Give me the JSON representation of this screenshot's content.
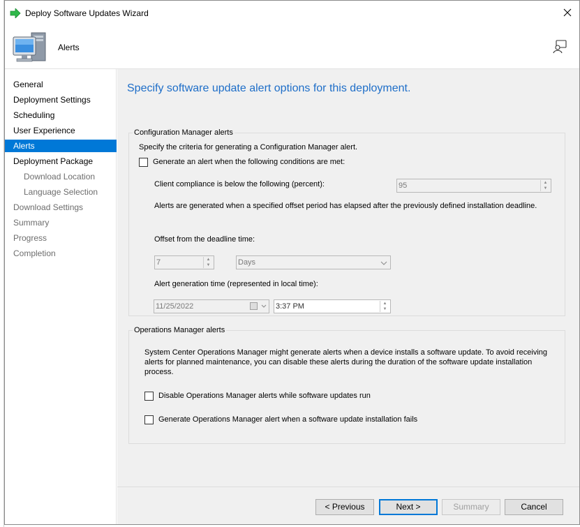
{
  "window": {
    "title": "Deploy Software Updates Wizard"
  },
  "header": {
    "page_name": "Alerts"
  },
  "nav": {
    "items": [
      {
        "label": "General",
        "state": "normal",
        "level": 0
      },
      {
        "label": "Deployment Settings",
        "state": "normal",
        "level": 0
      },
      {
        "label": "Scheduling",
        "state": "normal",
        "level": 0
      },
      {
        "label": "User Experience",
        "state": "normal",
        "level": 0
      },
      {
        "label": "Alerts",
        "state": "active",
        "level": 0
      },
      {
        "label": "Deployment Package",
        "state": "normal",
        "level": 0
      },
      {
        "label": "Download Location",
        "state": "dim",
        "level": 1
      },
      {
        "label": "Language Selection",
        "state": "dim",
        "level": 1
      },
      {
        "label": "Download Settings",
        "state": "dim",
        "level": 0
      },
      {
        "label": "Summary",
        "state": "dim",
        "level": 0
      },
      {
        "label": "Progress",
        "state": "dim",
        "level": 0
      },
      {
        "label": "Completion",
        "state": "dim",
        "level": 0
      }
    ]
  },
  "main": {
    "heading": "Specify software update alert options for this deployment.",
    "cm_group": {
      "label": "Configuration Manager alerts",
      "description": "Specify the criteria for generating a Configuration Manager alert.",
      "generate_checkbox_label": "Generate an alert when the following conditions are met:",
      "generate_checked": false,
      "compliance_label": "Client compliance is below the following (percent):",
      "compliance_value": "95",
      "offset_note": "Alerts are generated when a specified offset period has elapsed after the previously defined installation deadline.",
      "offset_label": "Offset from the deadline time:",
      "offset_value": "7",
      "offset_unit": "Days",
      "alert_time_label": "Alert generation time (represented in local time):",
      "alert_date": "11/25/2022",
      "alert_time": "3:37 PM"
    },
    "om_group": {
      "label": "Operations Manager alerts",
      "description": "System Center Operations Manager might generate alerts when a device installs a software update. To avoid receiving alerts for planned maintenance, you can disable these alerts during the duration of the software update installation process.",
      "disable_label": "Disable Operations Manager alerts while software updates run",
      "disable_checked": false,
      "fail_label": "Generate Operations Manager alert when a software update installation fails",
      "fail_checked": false
    }
  },
  "footer": {
    "previous_label": "< Previous",
    "next_label": "Next >",
    "summary_label": "Summary",
    "cancel_label": "Cancel"
  },
  "colors": {
    "accent": "#0078d7",
    "heading": "#1e6ec8",
    "arrow_green": "#2fb84a"
  },
  "icons": {
    "title": "green-arrow-icon",
    "header": "computer-monitor-icon",
    "help": "help-person-icon",
    "close": "close-icon"
  }
}
